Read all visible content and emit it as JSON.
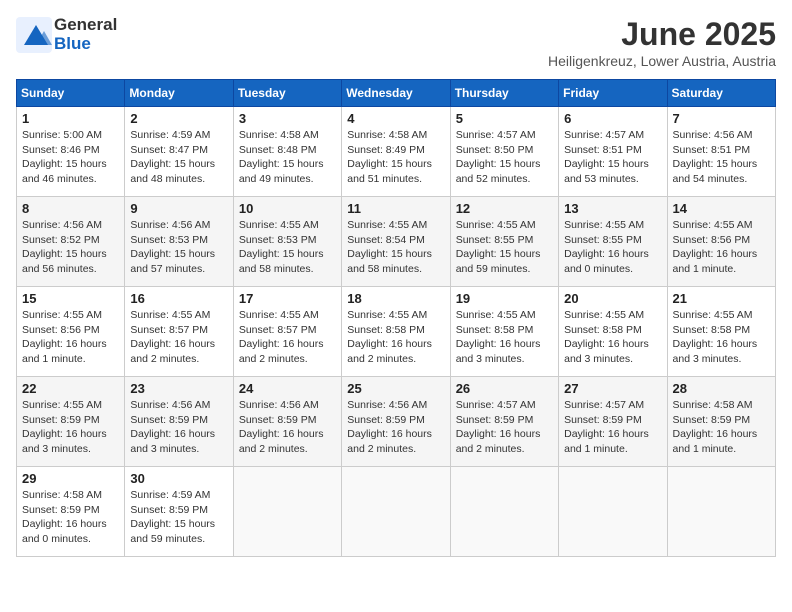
{
  "header": {
    "logo_general": "General",
    "logo_blue": "Blue",
    "month": "June 2025",
    "location": "Heiligenkreuz, Lower Austria, Austria"
  },
  "weekdays": [
    "Sunday",
    "Monday",
    "Tuesday",
    "Wednesday",
    "Thursday",
    "Friday",
    "Saturday"
  ],
  "weeks": [
    [
      {
        "day": "1",
        "info": "Sunrise: 5:00 AM\nSunset: 8:46 PM\nDaylight: 15 hours\nand 46 minutes."
      },
      {
        "day": "2",
        "info": "Sunrise: 4:59 AM\nSunset: 8:47 PM\nDaylight: 15 hours\nand 48 minutes."
      },
      {
        "day": "3",
        "info": "Sunrise: 4:58 AM\nSunset: 8:48 PM\nDaylight: 15 hours\nand 49 minutes."
      },
      {
        "day": "4",
        "info": "Sunrise: 4:58 AM\nSunset: 8:49 PM\nDaylight: 15 hours\nand 51 minutes."
      },
      {
        "day": "5",
        "info": "Sunrise: 4:57 AM\nSunset: 8:50 PM\nDaylight: 15 hours\nand 52 minutes."
      },
      {
        "day": "6",
        "info": "Sunrise: 4:57 AM\nSunset: 8:51 PM\nDaylight: 15 hours\nand 53 minutes."
      },
      {
        "day": "7",
        "info": "Sunrise: 4:56 AM\nSunset: 8:51 PM\nDaylight: 15 hours\nand 54 minutes."
      }
    ],
    [
      {
        "day": "8",
        "info": "Sunrise: 4:56 AM\nSunset: 8:52 PM\nDaylight: 15 hours\nand 56 minutes."
      },
      {
        "day": "9",
        "info": "Sunrise: 4:56 AM\nSunset: 8:53 PM\nDaylight: 15 hours\nand 57 minutes."
      },
      {
        "day": "10",
        "info": "Sunrise: 4:55 AM\nSunset: 8:53 PM\nDaylight: 15 hours\nand 58 minutes."
      },
      {
        "day": "11",
        "info": "Sunrise: 4:55 AM\nSunset: 8:54 PM\nDaylight: 15 hours\nand 58 minutes."
      },
      {
        "day": "12",
        "info": "Sunrise: 4:55 AM\nSunset: 8:55 PM\nDaylight: 15 hours\nand 59 minutes."
      },
      {
        "day": "13",
        "info": "Sunrise: 4:55 AM\nSunset: 8:55 PM\nDaylight: 16 hours\nand 0 minutes."
      },
      {
        "day": "14",
        "info": "Sunrise: 4:55 AM\nSunset: 8:56 PM\nDaylight: 16 hours\nand 1 minute."
      }
    ],
    [
      {
        "day": "15",
        "info": "Sunrise: 4:55 AM\nSunset: 8:56 PM\nDaylight: 16 hours\nand 1 minute."
      },
      {
        "day": "16",
        "info": "Sunrise: 4:55 AM\nSunset: 8:57 PM\nDaylight: 16 hours\nand 2 minutes."
      },
      {
        "day": "17",
        "info": "Sunrise: 4:55 AM\nSunset: 8:57 PM\nDaylight: 16 hours\nand 2 minutes."
      },
      {
        "day": "18",
        "info": "Sunrise: 4:55 AM\nSunset: 8:58 PM\nDaylight: 16 hours\nand 2 minutes."
      },
      {
        "day": "19",
        "info": "Sunrise: 4:55 AM\nSunset: 8:58 PM\nDaylight: 16 hours\nand 3 minutes."
      },
      {
        "day": "20",
        "info": "Sunrise: 4:55 AM\nSunset: 8:58 PM\nDaylight: 16 hours\nand 3 minutes."
      },
      {
        "day": "21",
        "info": "Sunrise: 4:55 AM\nSunset: 8:58 PM\nDaylight: 16 hours\nand 3 minutes."
      }
    ],
    [
      {
        "day": "22",
        "info": "Sunrise: 4:55 AM\nSunset: 8:59 PM\nDaylight: 16 hours\nand 3 minutes."
      },
      {
        "day": "23",
        "info": "Sunrise: 4:56 AM\nSunset: 8:59 PM\nDaylight: 16 hours\nand 3 minutes."
      },
      {
        "day": "24",
        "info": "Sunrise: 4:56 AM\nSunset: 8:59 PM\nDaylight: 16 hours\nand 2 minutes."
      },
      {
        "day": "25",
        "info": "Sunrise: 4:56 AM\nSunset: 8:59 PM\nDaylight: 16 hours\nand 2 minutes."
      },
      {
        "day": "26",
        "info": "Sunrise: 4:57 AM\nSunset: 8:59 PM\nDaylight: 16 hours\nand 2 minutes."
      },
      {
        "day": "27",
        "info": "Sunrise: 4:57 AM\nSunset: 8:59 PM\nDaylight: 16 hours\nand 1 minute."
      },
      {
        "day": "28",
        "info": "Sunrise: 4:58 AM\nSunset: 8:59 PM\nDaylight: 16 hours\nand 1 minute."
      }
    ],
    [
      {
        "day": "29",
        "info": "Sunrise: 4:58 AM\nSunset: 8:59 PM\nDaylight: 16 hours\nand 0 minutes."
      },
      {
        "day": "30",
        "info": "Sunrise: 4:59 AM\nSunset: 8:59 PM\nDaylight: 15 hours\nand 59 minutes."
      },
      null,
      null,
      null,
      null,
      null
    ]
  ]
}
